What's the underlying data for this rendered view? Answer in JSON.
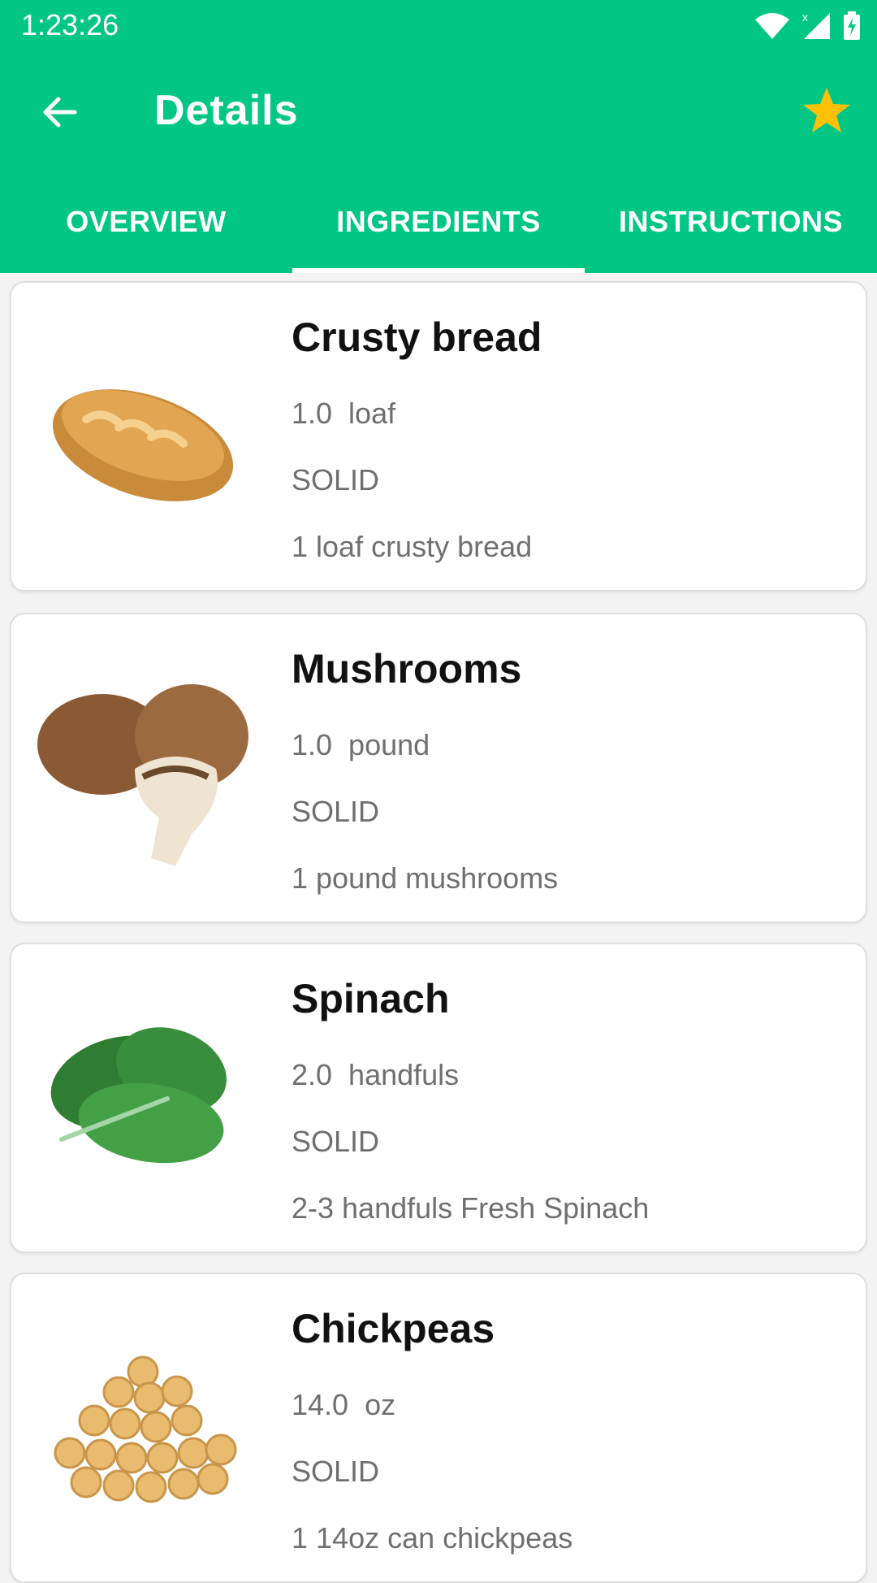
{
  "status_bar": {
    "time": "1:23:26"
  },
  "toolbar": {
    "title": "Details"
  },
  "tabs": [
    {
      "label": "OVERVIEW",
      "active": false
    },
    {
      "label": "INGREDIENTS",
      "active": true
    },
    {
      "label": "INSTRUCTIONS",
      "active": false
    }
  ],
  "ingredients": [
    {
      "name": "Crusty bread",
      "amount": "1.0",
      "unit": "loaf",
      "state": "SOLID",
      "original": "1 loaf crusty bread",
      "image": "bread"
    },
    {
      "name": "Mushrooms",
      "amount": "1.0",
      "unit": "pound",
      "state": "SOLID",
      "original": "1 pound mushrooms",
      "image": "mushroom"
    },
    {
      "name": "Spinach",
      "amount": "2.0",
      "unit": "handfuls",
      "state": "SOLID",
      "original": "2-3 handfuls Fresh Spinach",
      "image": "spinach"
    },
    {
      "name": "Chickpeas",
      "amount": "14.0",
      "unit": "oz",
      "state": "SOLID",
      "original": "1 14oz can chickpeas",
      "image": "chickpea"
    }
  ],
  "colors": {
    "primary": "#02c684",
    "star": "#ffc107"
  }
}
